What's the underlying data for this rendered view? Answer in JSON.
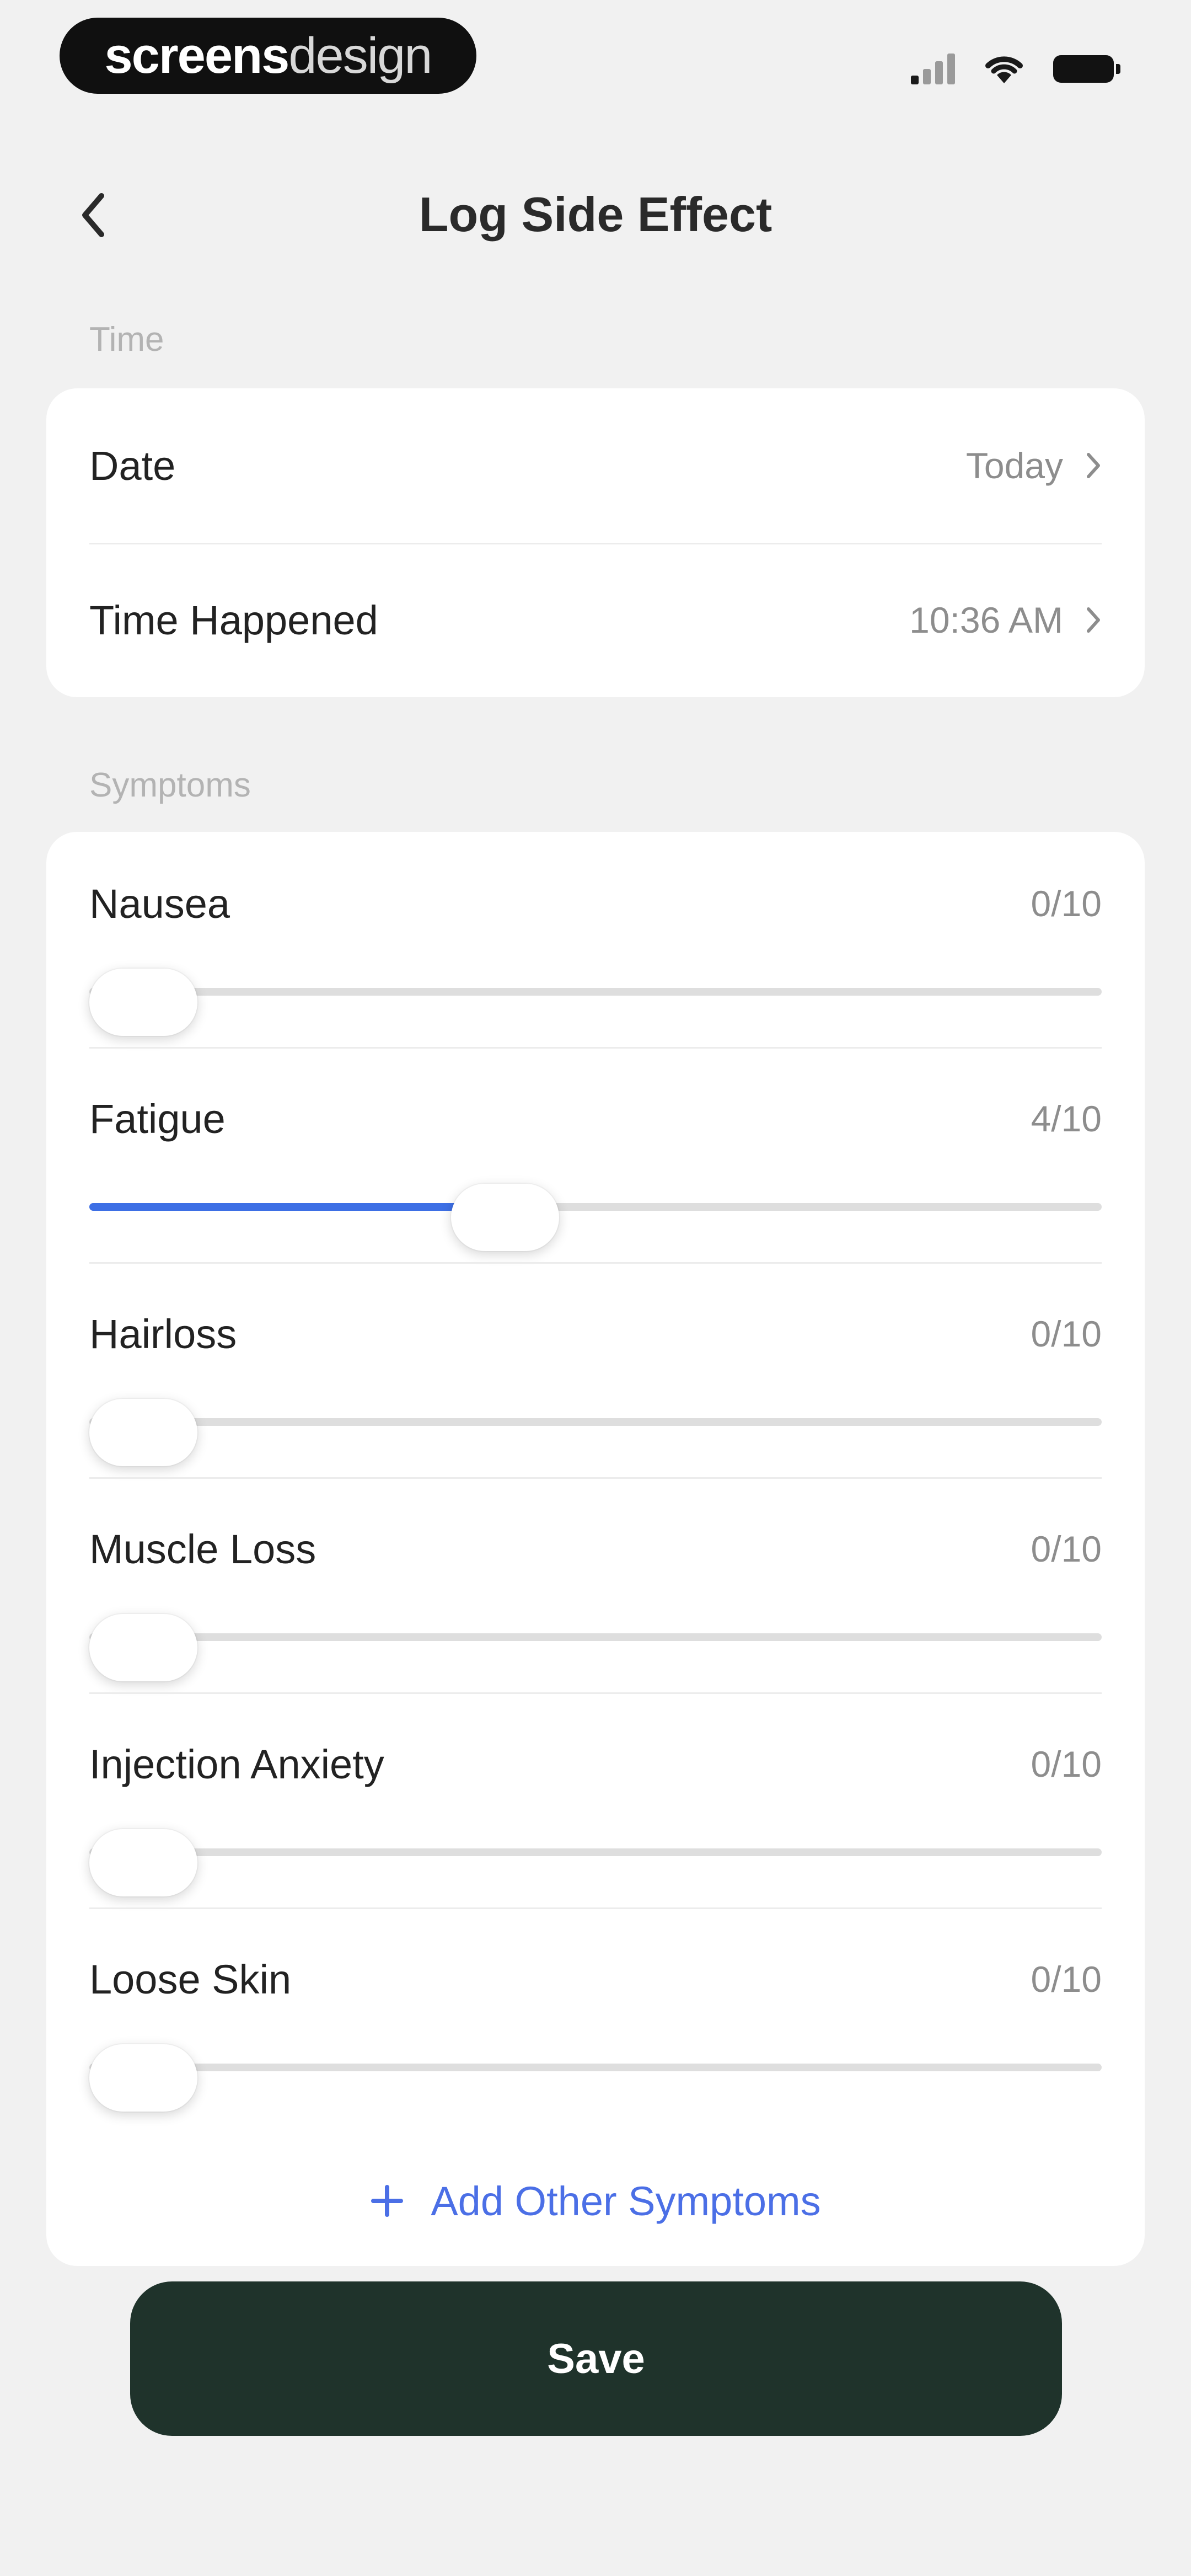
{
  "status_bar": {
    "brand_bold": "screens",
    "brand_light": "design"
  },
  "header": {
    "title": "Log Side Effect"
  },
  "time_section": {
    "label": "Time",
    "rows": [
      {
        "label": "Date",
        "value": "Today"
      },
      {
        "label": "Time Happened",
        "value": "10:36 AM"
      }
    ]
  },
  "symptoms_section": {
    "label": "Symptoms",
    "items": [
      {
        "name": "Nausea",
        "score": "0/10",
        "value": 0
      },
      {
        "name": "Fatigue",
        "score": "4/10",
        "value": 4
      },
      {
        "name": "Hairloss",
        "score": "0/10",
        "value": 0
      },
      {
        "name": "Muscle Loss",
        "score": "0/10",
        "value": 0
      },
      {
        "name": "Injection Anxiety",
        "score": "0/10",
        "value": 0
      },
      {
        "name": "Loose Skin",
        "score": "0/10",
        "value": 0
      }
    ],
    "max": 10,
    "add_label": "Add Other Symptoms"
  },
  "footer": {
    "save_label": "Save"
  },
  "colors": {
    "accent": "#3d6fe5",
    "link": "#4b6fe6",
    "save_button": "#1f332b"
  },
  "icons": {
    "back": "chevron-left-icon",
    "row_chevron": "chevron-right-icon",
    "add": "plus-icon"
  }
}
